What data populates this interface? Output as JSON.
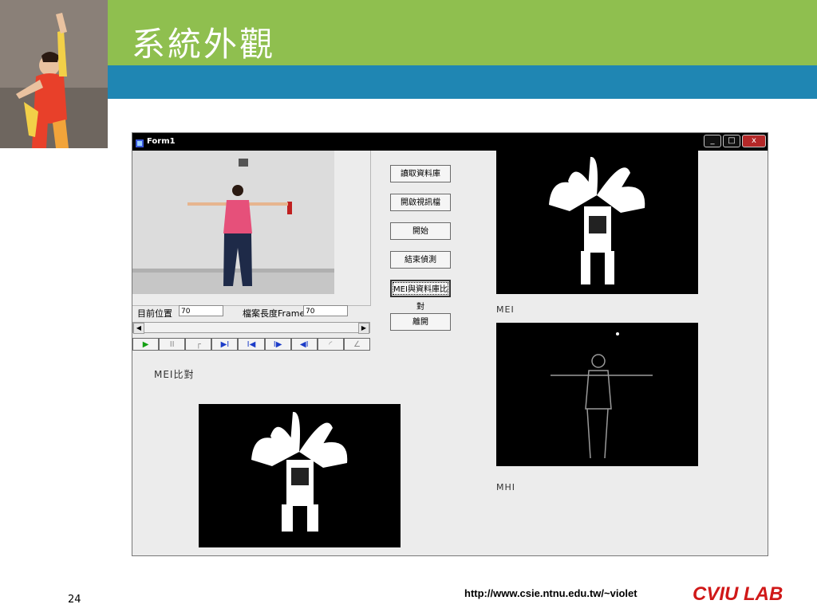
{
  "slide": {
    "title": "系統外觀",
    "page_number": "24",
    "url": "http://www.csie.ntnu.edu.tw/~violet",
    "lab_name": "CVIU LAB",
    "colors": {
      "header_green": "#8fbf4f",
      "header_blue": "#1f86b3",
      "lab_red": "#d01818"
    }
  },
  "app": {
    "window_title": "Form1",
    "window_controls": {
      "minimize": "_",
      "maximize": "□",
      "close": "x"
    },
    "position_label": "目前位置",
    "position_value": "70",
    "length_label": "檔案長度Frame",
    "length_value": "70",
    "buttons": {
      "read_db": "讀取資料庫",
      "open_video": "開啟視訊檔",
      "start": "開始",
      "end_detect": "結束偵測",
      "mei_compare": "MEI與資料庫比對",
      "exit": "離開"
    },
    "player_controls": [
      {
        "name": "play",
        "glyph": "▶"
      },
      {
        "name": "pause",
        "glyph": "II"
      },
      {
        "name": "stop",
        "glyph": "┌"
      },
      {
        "name": "next",
        "glyph": "▶I"
      },
      {
        "name": "first",
        "glyph": "I◀"
      },
      {
        "name": "step-forward",
        "glyph": "I▶"
      },
      {
        "name": "step-back",
        "glyph": "◀I"
      },
      {
        "name": "rotate",
        "glyph": "◜"
      },
      {
        "name": "angle",
        "glyph": "∠"
      }
    ],
    "compare_label": "MEI比對",
    "mei_label": "MEI",
    "mhi_label": "MHI"
  }
}
